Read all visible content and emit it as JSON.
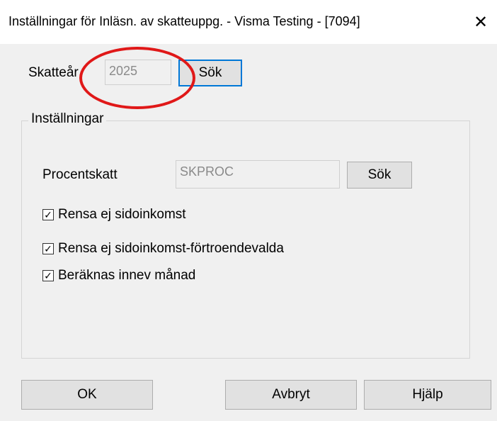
{
  "window": {
    "title": "Inställningar för Inläsn. av skatteuppg. - Visma Testing - [7094]",
    "close_glyph": "✕"
  },
  "tax_year": {
    "label": "Skatteår",
    "value": "2025",
    "search_button": "Sök"
  },
  "settings_group": {
    "legend": "Inställningar",
    "percent_tax": {
      "label": "Procentskatt",
      "value": "SKPROC",
      "search_button": "Sök"
    },
    "checkboxes": [
      {
        "label": "Rensa ej sidoinkomst",
        "checked": true
      },
      {
        "label": "Rensa ej sidoinkomst-förtroendevalda",
        "checked": true
      },
      {
        "label": "Beräknas innev månad",
        "checked": true
      }
    ]
  },
  "footer": {
    "ok": "OK",
    "cancel": "Avbryt",
    "help": "Hjälp"
  },
  "colors": {
    "annotation": "#e01818",
    "focus": "#0078d7"
  }
}
